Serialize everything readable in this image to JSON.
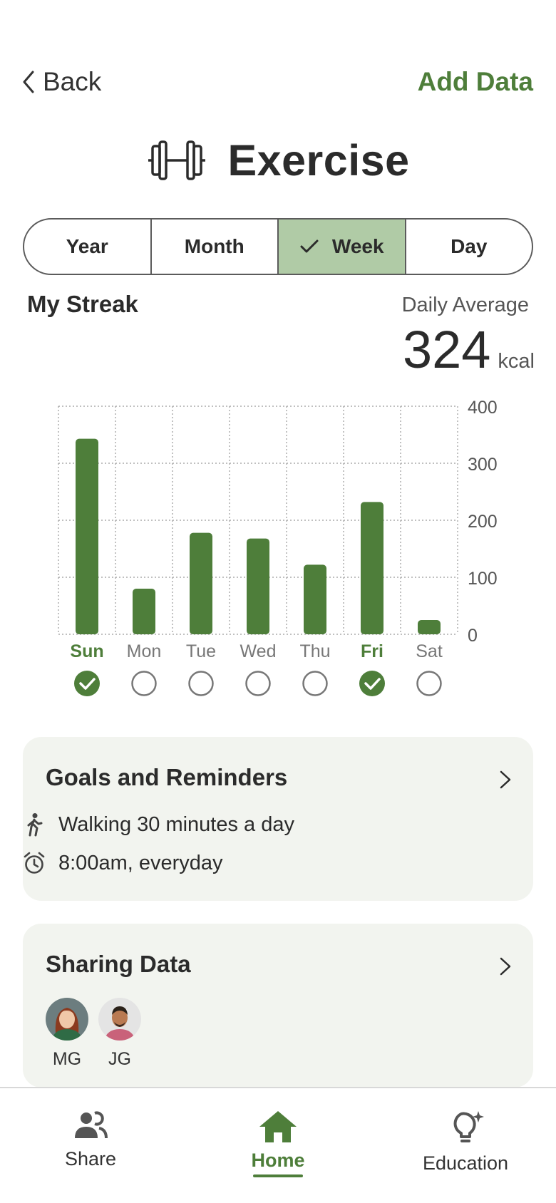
{
  "header": {
    "back_label": "Back",
    "action_label": "Add Data",
    "title": "Exercise",
    "title_icon": "dumbbell-icon"
  },
  "segmented": {
    "options": [
      "Year",
      "Month",
      "Week",
      "Day"
    ],
    "selected": "Week"
  },
  "stats": {
    "streak_label": "My Streak",
    "average_label": "Daily Average",
    "average_value": "324",
    "average_unit": "kcal"
  },
  "colors": {
    "accent": "#4e7e3a",
    "segment_active": "#b0cba6",
    "card_bg": "#f2f4ef"
  },
  "chart_data": {
    "type": "bar",
    "categories": [
      "Sun",
      "Mon",
      "Tue",
      "Wed",
      "Thu",
      "Fri",
      "Sat"
    ],
    "values": [
      343,
      80,
      178,
      168,
      122,
      232,
      25
    ],
    "ylim": [
      0,
      400
    ],
    "yticks": [
      "0",
      "100",
      "200",
      "300",
      "400"
    ],
    "highlighted": [
      "Sun",
      "Fri"
    ],
    "streak": [
      true,
      false,
      false,
      false,
      false,
      true,
      false
    ],
    "grid": true,
    "color": "#4e7e3a"
  },
  "goals": {
    "title": "Goals and Reminders",
    "items": [
      {
        "icon": "walking-icon",
        "text": "Walking 30 minutes a day"
      },
      {
        "icon": "alarm-clock-icon",
        "text": "8:00am, everyday"
      }
    ]
  },
  "sharing": {
    "title": "Sharing Data",
    "people": [
      {
        "initials": "MG"
      },
      {
        "initials": "JG"
      }
    ]
  },
  "nav": {
    "items": [
      {
        "label": "Share",
        "icon": "people-icon"
      },
      {
        "label": "Home",
        "icon": "home-icon"
      },
      {
        "label": "Education",
        "icon": "lightbulb-icon"
      }
    ],
    "active": "Home"
  }
}
